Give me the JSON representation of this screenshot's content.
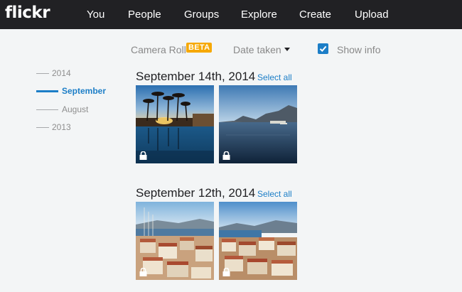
{
  "header": {
    "logo": "flickr",
    "nav": [
      "You",
      "People",
      "Groups",
      "Explore",
      "Create",
      "Upload"
    ]
  },
  "toolbar": {
    "camera_roll": "Camera Roll",
    "beta": "BETA",
    "sort_label": "Date taken",
    "show_info_label": "Show info",
    "show_info_checked": true
  },
  "timeline": {
    "items": [
      {
        "label": "2014",
        "active": false
      },
      {
        "label": "September",
        "active": true
      },
      {
        "label": "August",
        "active": false
      },
      {
        "label": "2013",
        "active": false
      }
    ]
  },
  "sections": [
    {
      "date": "September 14th, 2014",
      "select_all": "Select all",
      "photos": [
        "pool-palms-sunset",
        "harbor-dusk-sea"
      ]
    },
    {
      "date": "September 12th, 2014",
      "select_all": "Select all",
      "photos": [
        "harbor-town-rooftops",
        "coastal-town-rooftops"
      ]
    }
  ],
  "colors": {
    "topbar": "#212124",
    "accent": "#1c7ec7",
    "beta": "#f6a800",
    "background": "#f3f5f6"
  }
}
